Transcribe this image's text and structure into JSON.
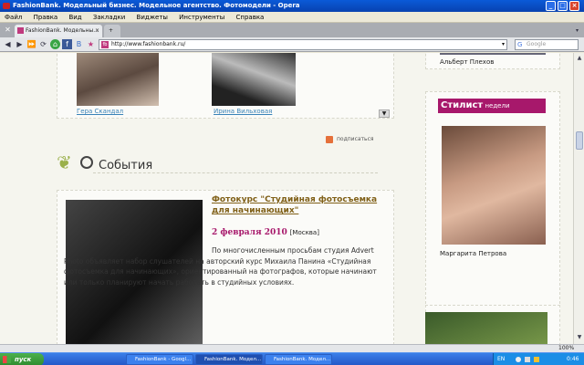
{
  "window": {
    "title": "FashionBank. Модельный бизнес. Модельное агентство. Фотомодели - Opera"
  },
  "menu": [
    "Файл",
    "Правка",
    "Вид",
    "Закладки",
    "Виджеты",
    "Инструменты",
    "Справка"
  ],
  "tabs": [
    {
      "label": "FashionBank. Модельны..."
    }
  ],
  "address": {
    "url": "http://www.fashionbank.ru/",
    "favicon": "fb"
  },
  "search": {
    "placeholder": "Google"
  },
  "top_models": [
    {
      "name": "Гера Скандал"
    },
    {
      "name": "Ирина Вильховая"
    }
  ],
  "events": {
    "heading": "События",
    "subscribe": "подписаться"
  },
  "event": {
    "title": "Фотокурс \"Студийная фотосъемка для начинающих\"",
    "date": "2 февраля 2010",
    "city": "[Москва]",
    "desc": "По многочисленным просьбам студия Advert Photo объявляет набор слушателей на авторский курс Михаила Панина «Студийная фотосъемка для начинающих», ориентированный на фотографов, которые начинают или только планируют начать работать в студийных условиях."
  },
  "sidebar": {
    "top_name": "Альберт Плехов",
    "stylist_label": "Стилист",
    "stylist_sub": "недели",
    "stylist_name": "Маргарита Петрова"
  },
  "statusbar": {
    "zoom": "100%"
  },
  "taskbar": {
    "start": "пуск",
    "tasks": [
      {
        "label": "FashionBank - Googl..."
      },
      {
        "label": "FashionBank. Модел..."
      },
      {
        "label": "FashionBank. Модел..."
      }
    ],
    "lang": "EN",
    "clock": "0:46"
  },
  "colors": {
    "accent": "#a7186b",
    "title_blue": "#0a5ad8"
  }
}
